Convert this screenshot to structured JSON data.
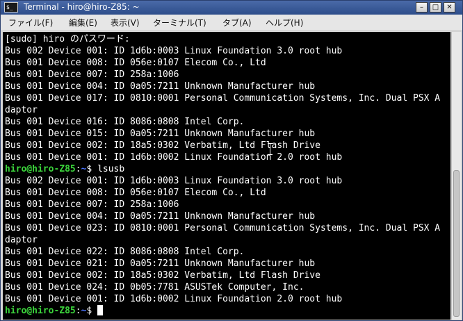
{
  "window": {
    "title": "Terminal - hiro@hiro-Z85: ~",
    "icon": "terminal-icon",
    "icon_glyph": "$_",
    "minimize_glyph": "–",
    "maximize_glyph": "□",
    "close_glyph": "✕"
  },
  "menubar": {
    "items": [
      {
        "label": "ファイル(F)"
      },
      {
        "label": "編集(E)"
      },
      {
        "label": "表示(V)"
      },
      {
        "label": "ターミナル(T)"
      },
      {
        "label": "タブ(A)"
      },
      {
        "label": "ヘルプ(H)"
      }
    ]
  },
  "terminal": {
    "colors": {
      "background": "#000000",
      "foreground": "#ffffff",
      "prompt_userhost": "#3cd63c",
      "prompt_path": "#4b74ff"
    },
    "lines": [
      {
        "text": "[sudo] hiro のパスワード:"
      },
      {
        "text": "Bus 002 Device 001: ID 1d6b:0003 Linux Foundation 3.0 root hub"
      },
      {
        "text": "Bus 001 Device 008: ID 056e:0107 Elecom Co., Ltd"
      },
      {
        "text": "Bus 001 Device 007: ID 258a:1006"
      },
      {
        "text": "Bus 001 Device 004: ID 0a05:7211 Unknown Manufacturer hub"
      },
      {
        "text": "Bus 001 Device 017: ID 0810:0001 Personal Communication Systems, Inc. Dual PSX A"
      },
      {
        "text": "daptor"
      },
      {
        "text": "Bus 001 Device 016: ID 8086:0808 Intel Corp."
      },
      {
        "text": "Bus 001 Device 015: ID 0a05:7211 Unknown Manufacturer hub"
      },
      {
        "text": "Bus 001 Device 002: ID 18a5:0302 Verbatim, Ltd Flash Drive"
      },
      {
        "text": "Bus 001 Device 001: ID 1d6b:0002 Linux Foundation 2.0 root hub"
      },
      {
        "prompt": {
          "userhost": "hiro@hiro-Z85",
          "sep": ":",
          "path": "~",
          "symbol": "$ ",
          "command": "lsusb"
        }
      },
      {
        "text": "Bus 002 Device 001: ID 1d6b:0003 Linux Foundation 3.0 root hub"
      },
      {
        "text": "Bus 001 Device 008: ID 056e:0107 Elecom Co., Ltd"
      },
      {
        "text": "Bus 001 Device 007: ID 258a:1006"
      },
      {
        "text": "Bus 001 Device 004: ID 0a05:7211 Unknown Manufacturer hub"
      },
      {
        "text": "Bus 001 Device 023: ID 0810:0001 Personal Communication Systems, Inc. Dual PSX A"
      },
      {
        "text": "daptor"
      },
      {
        "text": "Bus 001 Device 022: ID 8086:0808 Intel Corp."
      },
      {
        "text": "Bus 001 Device 021: ID 0a05:7211 Unknown Manufacturer hub"
      },
      {
        "text": "Bus 001 Device 002: ID 18a5:0302 Verbatim, Ltd Flash Drive"
      },
      {
        "text": "Bus 001 Device 024: ID 0b05:7781 ASUSTek Computer, Inc."
      },
      {
        "text": "Bus 001 Device 001: ID 1d6b:0002 Linux Foundation 2.0 root hub"
      },
      {
        "prompt": {
          "userhost": "hiro@hiro-Z85",
          "sep": ":",
          "path": "~",
          "symbol": "$ ",
          "command": ""
        },
        "cursor": true
      }
    ]
  },
  "scrollbar": {
    "thumb_start_fraction": 0.48,
    "thumb_size_fraction": 0.52
  }
}
